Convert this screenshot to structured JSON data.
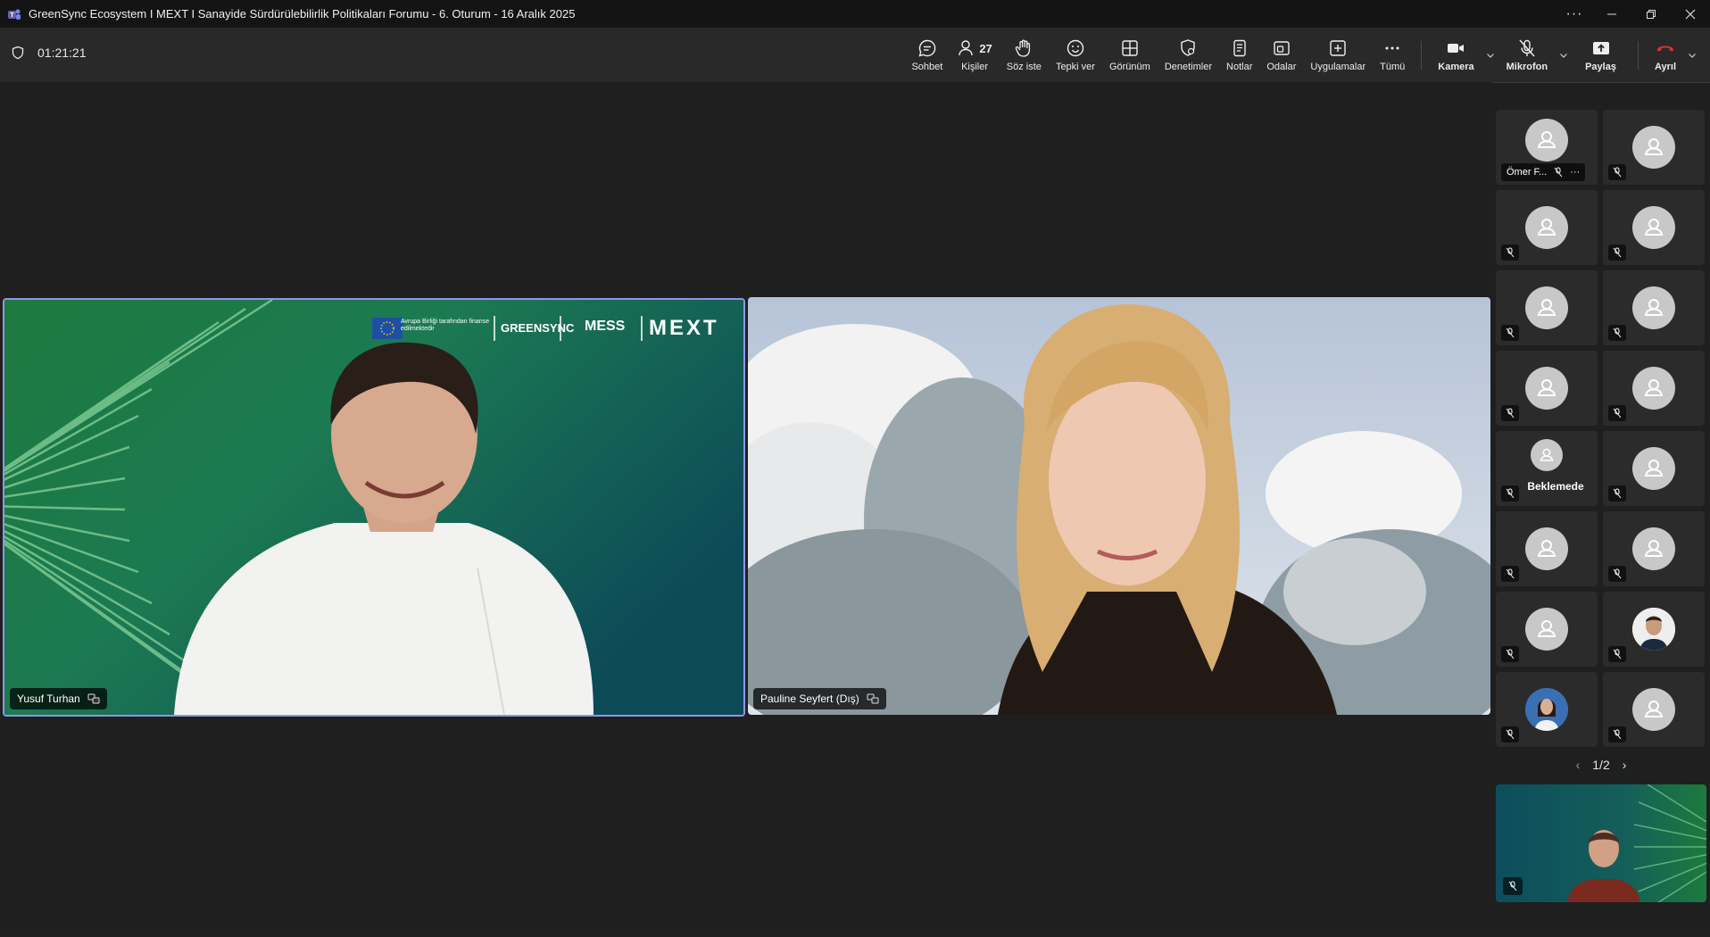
{
  "window": {
    "title": "GreenSync Ecosystem I MEXT I Sanayide Sürdürülebilirlik Politikaları Forumu - 6. Oturum - 16 Aralık 2025"
  },
  "toolbar": {
    "timer": "01:21:21",
    "people_count": "27",
    "items": [
      {
        "label": "Sohbet",
        "icon": "chat-icon"
      },
      {
        "label": "Kişiler",
        "icon": "people-icon"
      },
      {
        "label": "Söz iste",
        "icon": "hand-icon"
      },
      {
        "label": "Tepki ver",
        "icon": "emoji-icon"
      },
      {
        "label": "Görünüm",
        "icon": "grid-view-icon"
      },
      {
        "label": "Denetimler",
        "icon": "shield-gear-icon"
      },
      {
        "label": "Notlar",
        "icon": "notes-icon"
      },
      {
        "label": "Odalar",
        "icon": "rooms-icon"
      },
      {
        "label": "Uygulamalar",
        "icon": "add-apps-icon"
      },
      {
        "label": "Tümü",
        "icon": "more-icon"
      }
    ],
    "camera_label": "Kamera",
    "mic_label": "Mikrofon",
    "share_label": "Paylaş",
    "leave_label": "Ayrıl",
    "accent_leave": "#d13438"
  },
  "stage": {
    "participants": [
      {
        "name": "Yusuf Turhan",
        "background": "green-teal",
        "active_speaker": true
      },
      {
        "name": "Pauline Seyfert (Dış)",
        "background": "clouds",
        "active_speaker": false
      }
    ],
    "banner_text": "Avrupa Birliği tarafından finanse edilmektedir",
    "banner_logos": [
      "GREENSYNC",
      "MESS",
      "MEXT"
    ]
  },
  "sidebar": {
    "first_tile_name": "Ömer F...",
    "waiting_label": "Beklemede",
    "pager": "1/2"
  },
  "colors": {
    "active_border": "#8f95e8",
    "background": "#1f1f1f",
    "toolbar": "#292929"
  }
}
